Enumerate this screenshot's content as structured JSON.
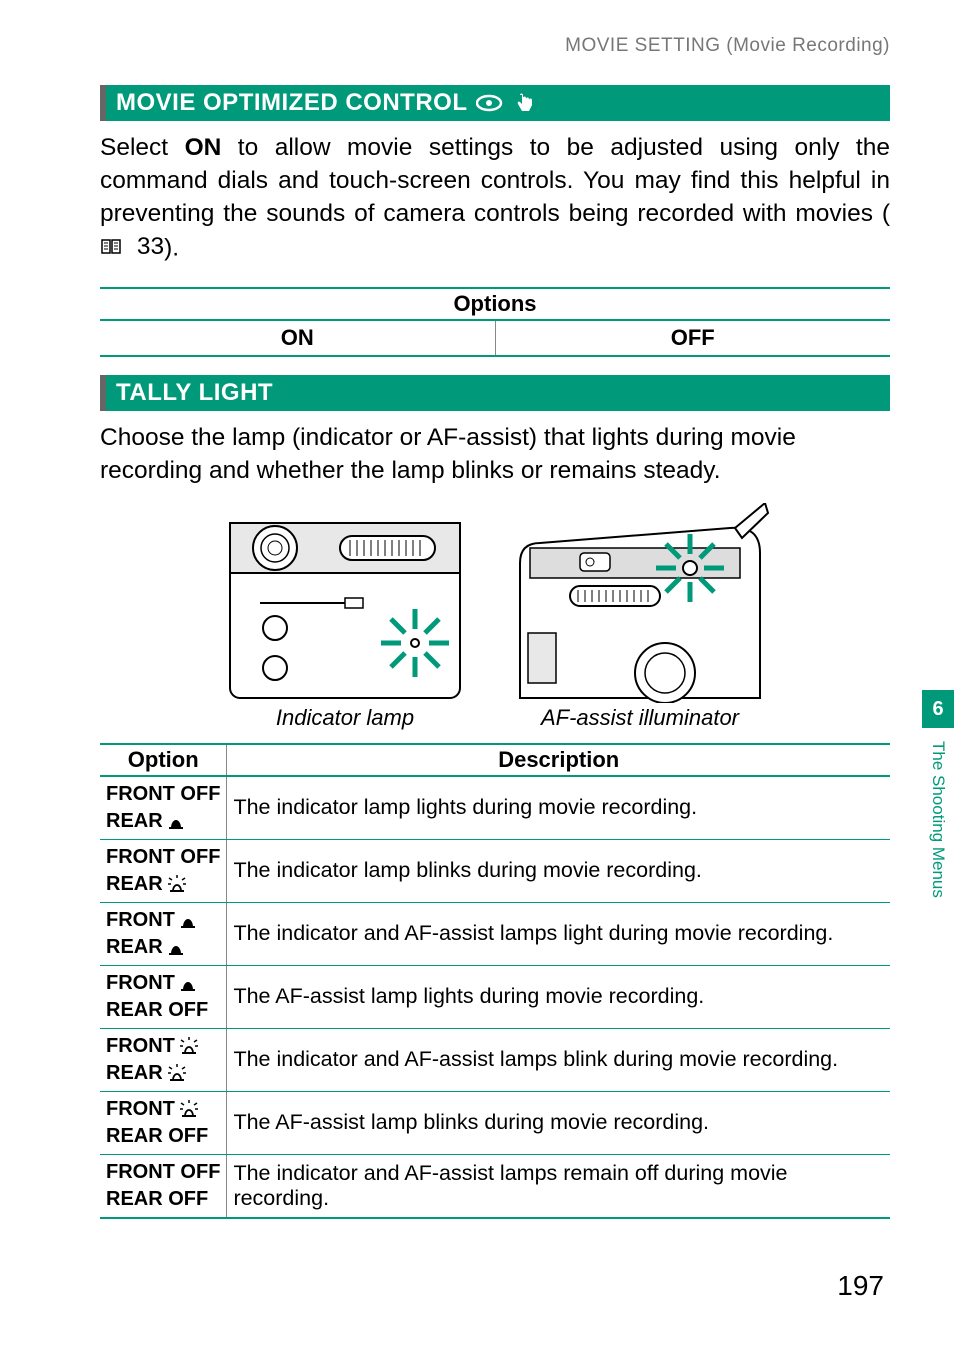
{
  "breadcrumb": "MOVIE SETTING (Movie Recording)",
  "section1": {
    "title": "MOVIE OPTIMIZED CONTROL",
    "body_pre": "Select ",
    "body_bold": "ON",
    "body_post": " to allow movie settings to be adjusted using only the command dials and touch-screen controls. You may find this helpful in preventing the sounds of camera controls being recorded with movies (",
    "pageref": "33",
    "body_tail": ").",
    "options_header": "Options",
    "options": [
      "ON",
      "OFF"
    ]
  },
  "section2": {
    "title": "TALLY LIGHT",
    "body": "Choose the lamp (indicator or AF-assist) that lights during movie recording and whether the lamp blinks or remains steady.",
    "fig1_caption": "Indicator lamp",
    "fig2_caption": "AF-assist illuminator",
    "table": {
      "headers": [
        "Option",
        "Description"
      ],
      "rows": [
        {
          "front": "FRONT OFF",
          "front_icon": "",
          "rear": "REAR",
          "rear_icon": "steady",
          "desc": "The indicator lamp lights during movie recording."
        },
        {
          "front": "FRONT OFF",
          "front_icon": "",
          "rear": "REAR",
          "rear_icon": "blink",
          "desc": "The indicator lamp blinks during movie recording."
        },
        {
          "front": "FRONT",
          "front_icon": "steady",
          "rear": "REAR",
          "rear_icon": "steady",
          "desc": "The indicator and AF-assist lamps light during movie recording."
        },
        {
          "front": "FRONT",
          "front_icon": "steady",
          "rear": "REAR OFF",
          "rear_icon": "",
          "desc": "The AF-assist lamp lights during movie recording."
        },
        {
          "front": "FRONT",
          "front_icon": "blink",
          "rear": "REAR",
          "rear_icon": "blink",
          "desc": "The indicator and AF-assist lamps blink during movie recording."
        },
        {
          "front": "FRONT",
          "front_icon": "blink",
          "rear": "REAR OFF",
          "rear_icon": "",
          "desc": "The AF-assist lamp blinks during movie recording."
        },
        {
          "front": "FRONT OFF",
          "front_icon": "",
          "rear": "REAR OFF",
          "rear_icon": "",
          "desc": "The indicator and AF-assist lamps remain off during movie recording."
        }
      ]
    }
  },
  "side_tab": "6",
  "side_label": "The Shooting Menus",
  "page_number": "197"
}
